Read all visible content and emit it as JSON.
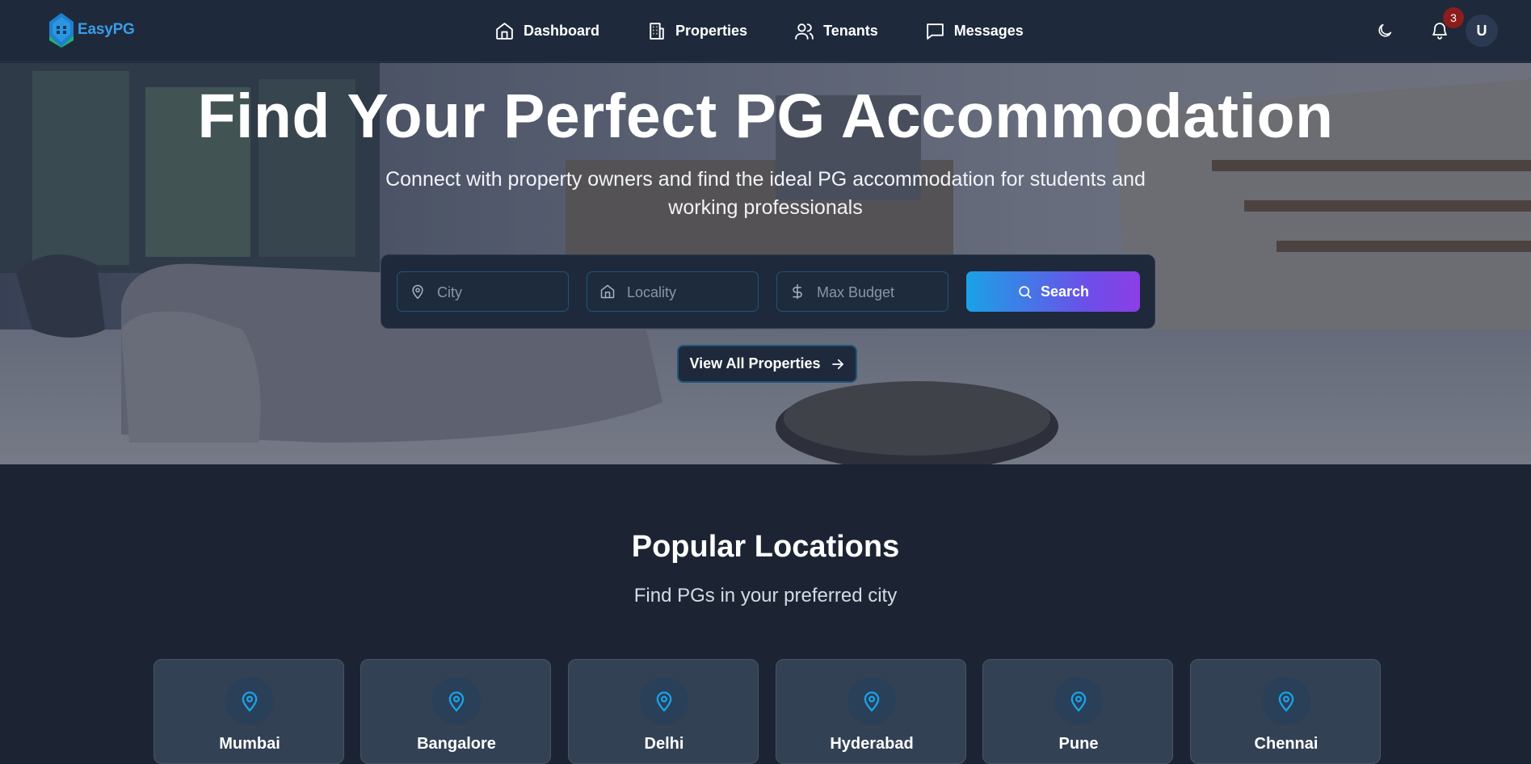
{
  "brand": {
    "name": "EasyPG"
  },
  "nav": {
    "links": [
      {
        "label": "Dashboard",
        "icon": "home-icon"
      },
      {
        "label": "Properties",
        "icon": "building-icon"
      },
      {
        "label": "Tenants",
        "icon": "users-icon"
      },
      {
        "label": "Messages",
        "icon": "message-icon"
      }
    ],
    "notification_count": "3",
    "avatar_initial": "U"
  },
  "hero": {
    "title": "Find Your Perfect PG Accommodation",
    "subtitle": "Connect with property owners and find the ideal PG accommodation for students and working professionals",
    "search": {
      "city_placeholder": "City",
      "locality_placeholder": "Locality",
      "budget_placeholder": "Max Budget",
      "button_label": "Search"
    },
    "view_all_label": "View All Properties"
  },
  "popular": {
    "title": "Popular Locations",
    "subtitle": "Find PGs in your preferred city",
    "cities": [
      "Mumbai",
      "Bangalore",
      "Delhi",
      "Hyderabad",
      "Pune",
      "Chennai"
    ]
  },
  "colors": {
    "background": "#1c2434",
    "navbar": "#1e293b",
    "brand": "#3b9ce6",
    "accent_cyan": "#1aa2e6",
    "accent_purple": "#8b3fe6",
    "badge": "#8b1d1d",
    "card": "#334155"
  }
}
